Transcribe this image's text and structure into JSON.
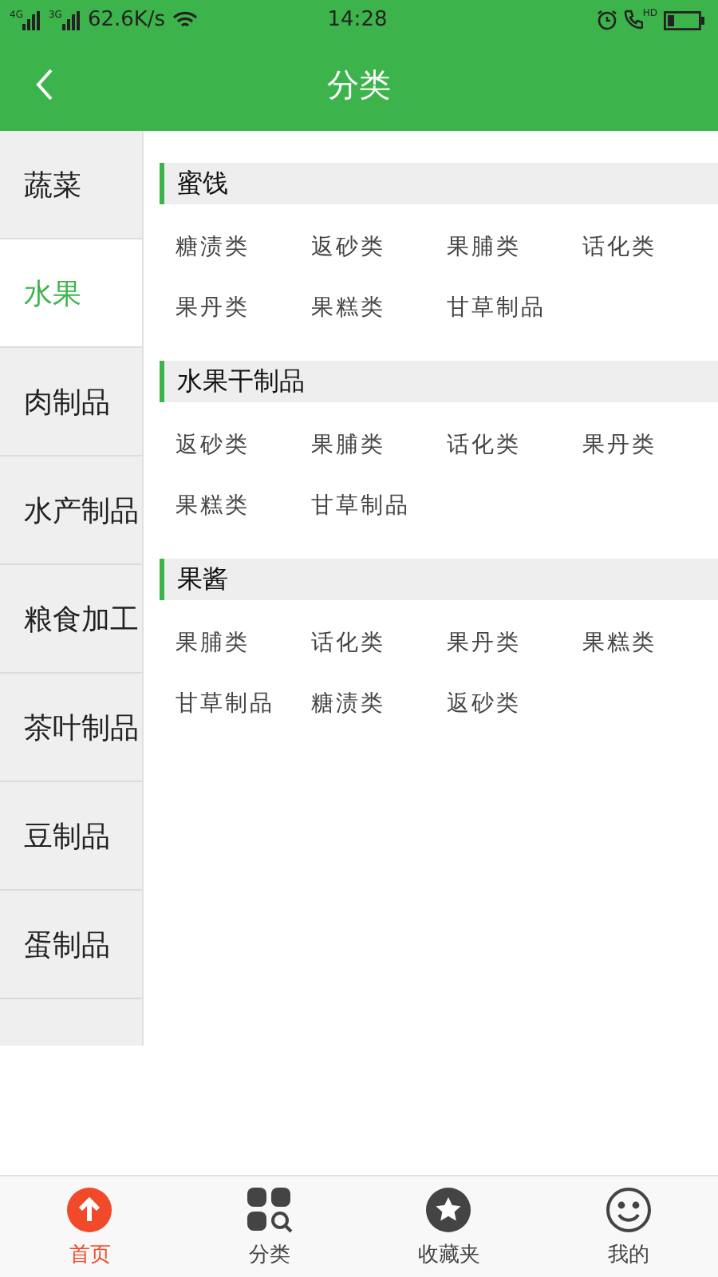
{
  "status_bar": {
    "network_1": "4G",
    "network_2": "3G",
    "speed": "62.6K/s",
    "time": "14:28",
    "call_badge": "HD"
  },
  "header": {
    "title": "分类"
  },
  "sidebar": {
    "items": [
      {
        "label": "蔬菜",
        "selected": false
      },
      {
        "label": "水果",
        "selected": true
      },
      {
        "label": "肉制品",
        "selected": false
      },
      {
        "label": "水产制品",
        "selected": false
      },
      {
        "label": "粮食加工",
        "selected": false
      },
      {
        "label": "茶叶制品",
        "selected": false
      },
      {
        "label": "豆制品",
        "selected": false
      },
      {
        "label": "蛋制品",
        "selected": false
      }
    ]
  },
  "sections": [
    {
      "title": "蜜饯",
      "items": [
        "糖渍类",
        "返砂类",
        "果脯类",
        "话化类",
        "果丹类",
        "果糕类",
        "甘草制品"
      ]
    },
    {
      "title": "水果干制品",
      "items": [
        "返砂类",
        "果脯类",
        "话化类",
        "果丹类",
        "果糕类",
        "甘草制品"
      ]
    },
    {
      "title": "果酱",
      "items": [
        "果脯类",
        "话化类",
        "果丹类",
        "果糕类",
        "甘草制品",
        "糖渍类",
        "返砂类"
      ]
    }
  ],
  "tab_bar": {
    "items": [
      {
        "label": "首页",
        "kind": "home",
        "selected": true
      },
      {
        "label": "分类",
        "kind": "category",
        "selected": false
      },
      {
        "label": "收藏夹",
        "kind": "favorites",
        "selected": false
      },
      {
        "label": "我的",
        "kind": "profile",
        "selected": false
      }
    ]
  }
}
